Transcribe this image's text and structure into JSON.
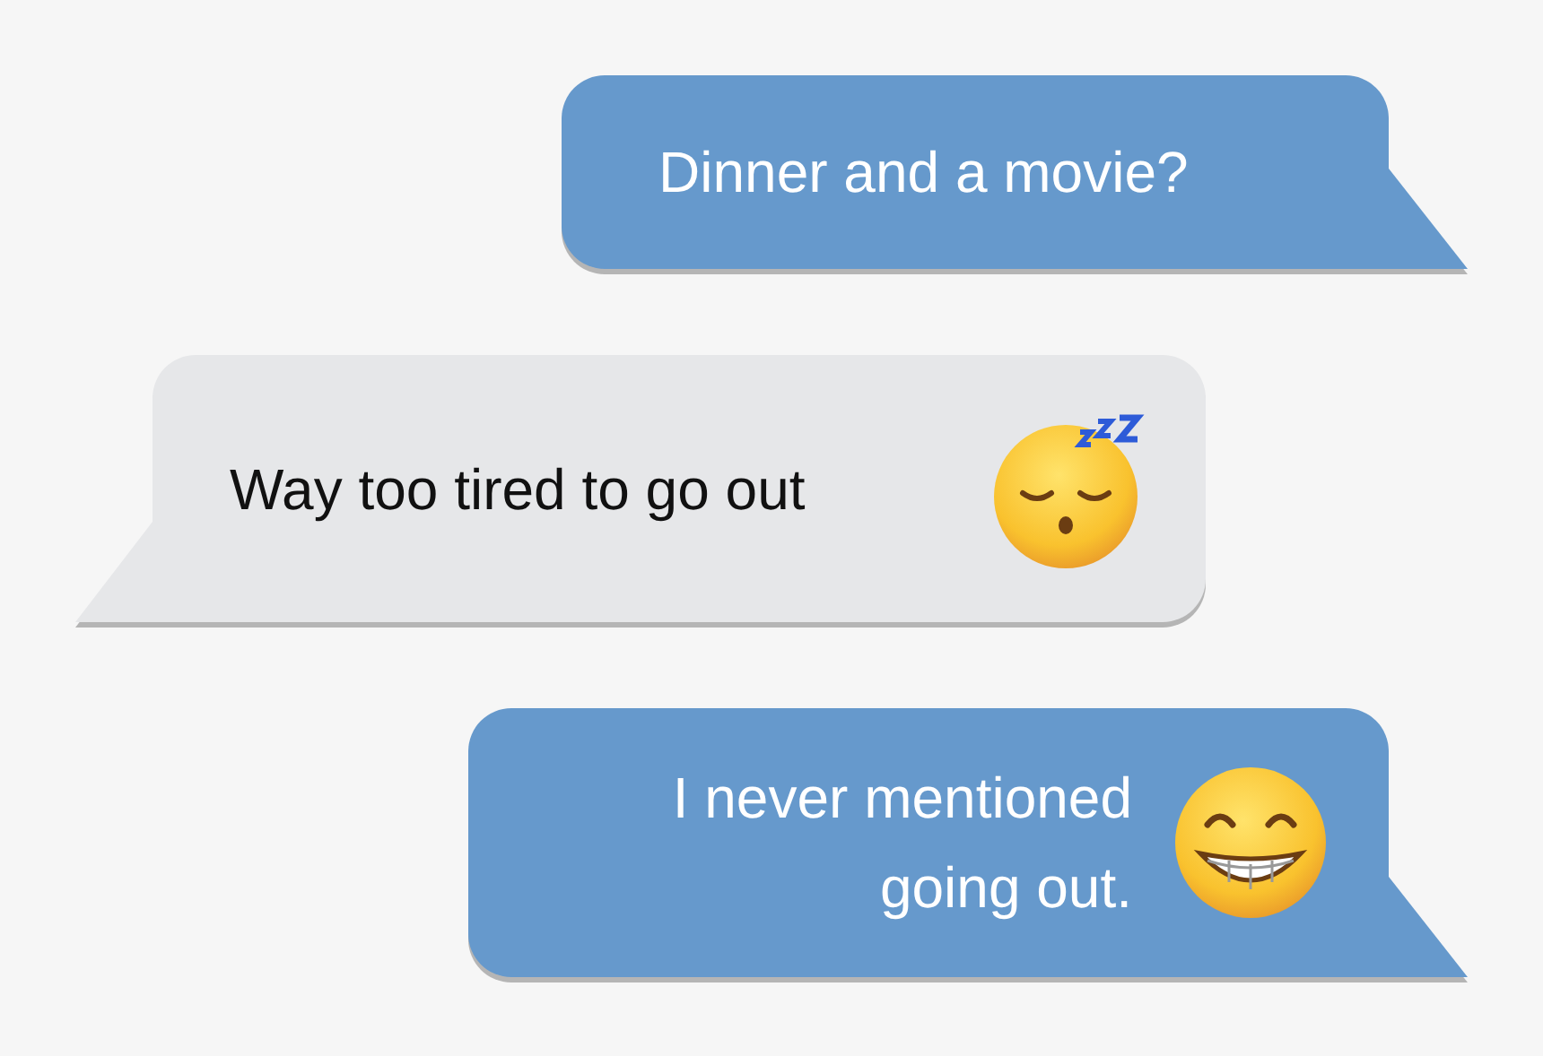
{
  "messages": [
    {
      "kind": "sent",
      "text": "Dinner and a movie?"
    },
    {
      "kind": "received",
      "text": "Way too tired to go out"
    },
    {
      "kind": "sent",
      "text": "I never mentioned going out."
    }
  ]
}
